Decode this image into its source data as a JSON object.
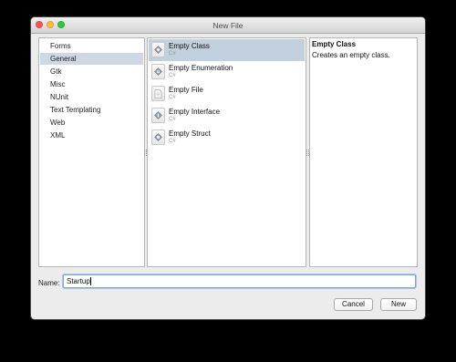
{
  "window": {
    "title": "New File"
  },
  "categories": {
    "items": [
      "Forms",
      "General",
      "Gtk",
      "Misc",
      "NUnit",
      "Text Templating",
      "Web",
      "XML"
    ],
    "selected": "General"
  },
  "templates": {
    "items": [
      {
        "name": "Empty Class",
        "lang": "C#",
        "icon": "class-icon",
        "selected": true
      },
      {
        "name": "Empty Enumeration",
        "lang": "C#",
        "icon": "enumeration-icon",
        "selected": false
      },
      {
        "name": "Empty File",
        "lang": "C#",
        "icon": "file-icon",
        "selected": false
      },
      {
        "name": "Empty Interface",
        "lang": "C#",
        "icon": "interface-icon",
        "selected": false
      },
      {
        "name": "Empty Struct",
        "lang": "C#",
        "icon": "struct-icon",
        "selected": false
      }
    ]
  },
  "description": {
    "title": "Empty Class",
    "text": "Creates an empty class."
  },
  "name_field": {
    "label": "Name:",
    "value": "Startup"
  },
  "buttons": {
    "cancel": "Cancel",
    "new": "New"
  },
  "colors": {
    "selection": "#c2cfdc",
    "focus_ring": "#7ba6d6"
  }
}
